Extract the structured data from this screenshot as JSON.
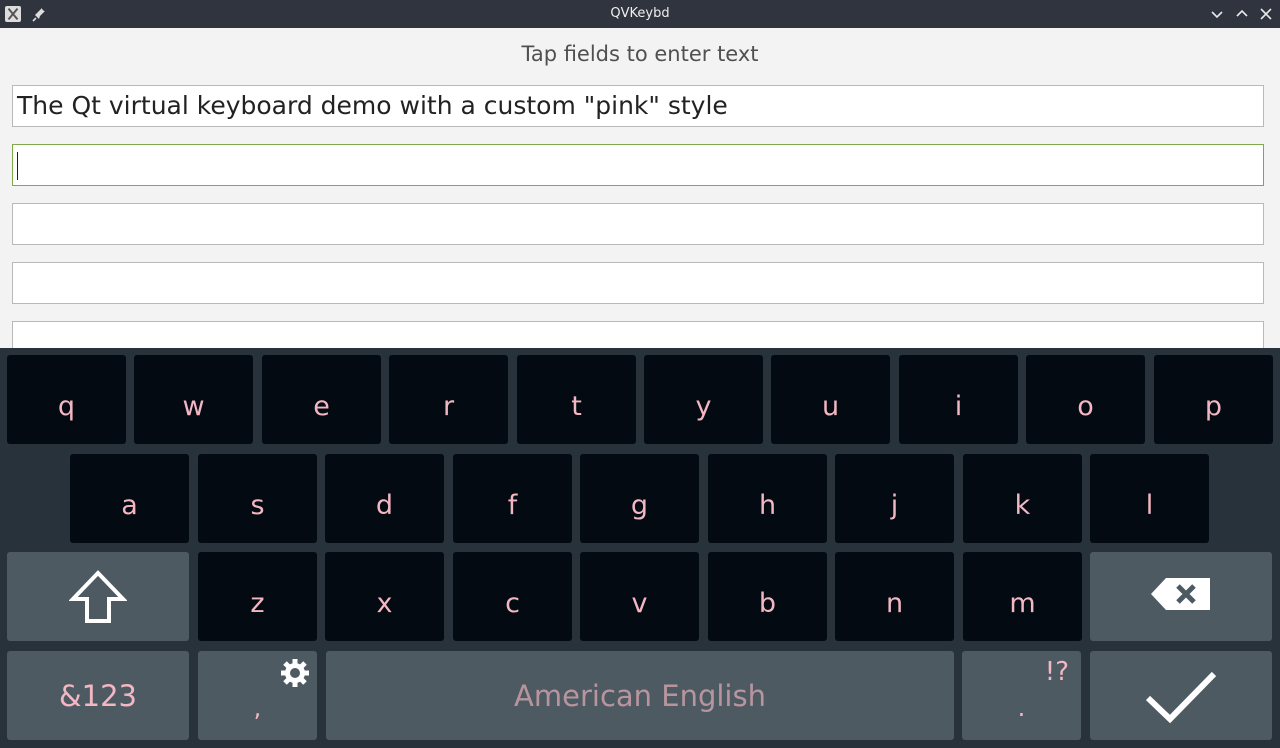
{
  "window": {
    "title": "QVKeybd"
  },
  "main": {
    "hint": "Tap fields to enter text",
    "fields": [
      {
        "value": "The Qt virtual keyboard demo with a custom \"pink\" style"
      },
      {
        "value": ""
      },
      {
        "value": ""
      },
      {
        "value": ""
      },
      {
        "value": ""
      }
    ]
  },
  "keyboard": {
    "row1": [
      "q",
      "w",
      "e",
      "r",
      "t",
      "y",
      "u",
      "i",
      "o",
      "p"
    ],
    "row2": [
      "a",
      "s",
      "d",
      "f",
      "g",
      "h",
      "j",
      "k",
      "l"
    ],
    "row3": [
      "z",
      "x",
      "c",
      "v",
      "b",
      "n",
      "m"
    ],
    "symbols_label": "&123",
    "comma_label": ",",
    "space_label": "American English",
    "period_label": ".",
    "punct_hint": "!?",
    "icons": {
      "shift": "shift-icon",
      "backspace": "backspace-icon",
      "enter": "checkmark-icon",
      "settings": "gear-icon"
    },
    "colors": {
      "background": "#27323a",
      "key": "#030a12",
      "function_key": "#4d5a62",
      "key_text": "#f3b6c3"
    }
  }
}
